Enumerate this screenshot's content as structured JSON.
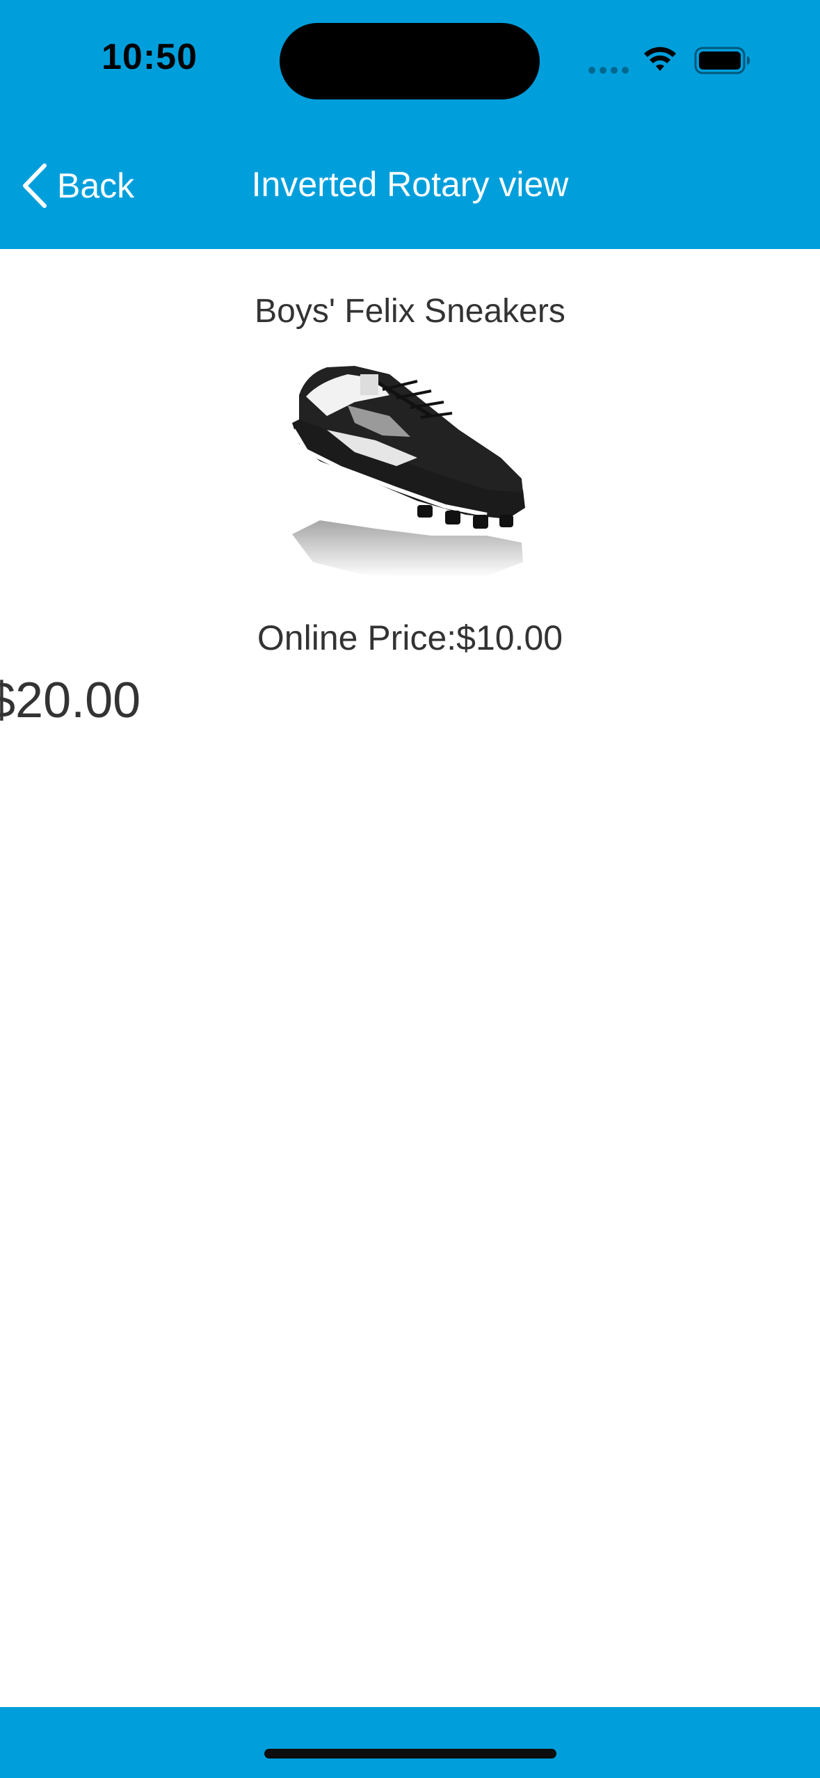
{
  "status_bar": {
    "time": "10:50",
    "icons": [
      "cellular-dots-icon",
      "wifi-icon",
      "battery-icon"
    ]
  },
  "nav": {
    "back_label": "Back",
    "back_icon": "chevron-left-icon",
    "title": "Inverted Rotary view"
  },
  "product": {
    "name": "Boys' Felix Sneakers",
    "image": "sneaker-image",
    "online_price": "Online Price:$10.00",
    "adjacent_price": "$20.00"
  },
  "colors": {
    "accent": "#009fdc",
    "text": "#333333",
    "background": "#ffffff"
  }
}
